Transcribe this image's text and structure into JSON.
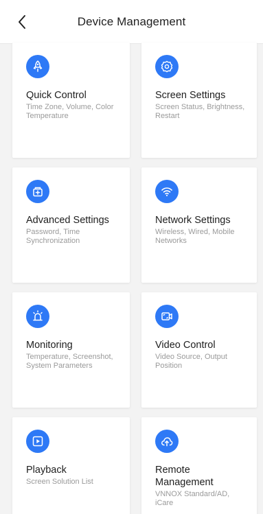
{
  "header": {
    "title": "Device Management"
  },
  "colors": {
    "accent": "#2e79f6",
    "background": "#f3f3f3"
  },
  "cards": [
    {
      "title": "Quick Control",
      "description": "Time Zone, Volume, Color Temperature",
      "icon": "rocket-icon"
    },
    {
      "title": "Screen Settings",
      "description": "Screen Status, Brightness, Restart",
      "icon": "gear-icon"
    },
    {
      "title": "Advanced Settings",
      "description": "Password, Time Synchronization",
      "icon": "advanced-settings-icon"
    },
    {
      "title": "Network Settings",
      "description": "Wireless, Wired, Mobile Networks",
      "icon": "wifi-icon"
    },
    {
      "title": "Monitoring",
      "description": "Temperature, Screenshot, System Parameters",
      "icon": "alarm-light-icon"
    },
    {
      "title": "Video Control",
      "description": "Video Source, Output Position",
      "icon": "video-control-icon"
    },
    {
      "title": "Playback",
      "description": "Screen Solution List",
      "icon": "playback-icon"
    },
    {
      "title": "Remote Management",
      "description": "VNNOX Standard/AD, iCare",
      "icon": "cloud-upload-icon"
    }
  ]
}
